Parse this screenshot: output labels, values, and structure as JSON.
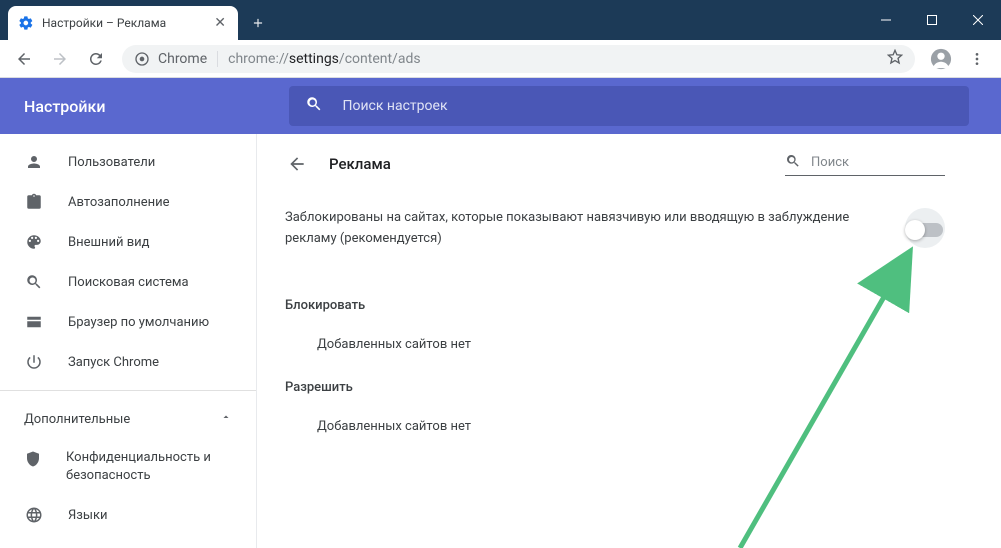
{
  "window": {
    "tab_title": "Настройки – Реклама"
  },
  "address": {
    "scheme_label": "Chrome",
    "url_dim1": "chrome://",
    "url_mid": "settings",
    "url_dim2": "/content/ads"
  },
  "blueheader": {
    "title": "Настройки",
    "search_placeholder": "Поиск настроек"
  },
  "sidebar": {
    "items": [
      {
        "label": "Пользователи"
      },
      {
        "label": "Автозаполнение"
      },
      {
        "label": "Внешний вид"
      },
      {
        "label": "Поисковая система"
      },
      {
        "label": "Браузер по умолчанию"
      },
      {
        "label": "Запуск Chrome"
      }
    ],
    "advanced_label": "Дополнительные",
    "adv_items": [
      {
        "label": "Конфиденциальность и безопасность"
      },
      {
        "label": "Языки"
      }
    ]
  },
  "card": {
    "title": "Реклама",
    "search_placeholder": "Поиск",
    "toggle_text": "Заблокированы на сайтах, которые показывают навязчивую или вводящую в заблуждение рекламу (рекомендуется)",
    "toggle_on": false,
    "block_heading": "Блокировать",
    "block_empty": "Добавленных сайтов нет",
    "allow_heading": "Разрешить",
    "allow_empty": "Добавленных сайтов нет"
  }
}
